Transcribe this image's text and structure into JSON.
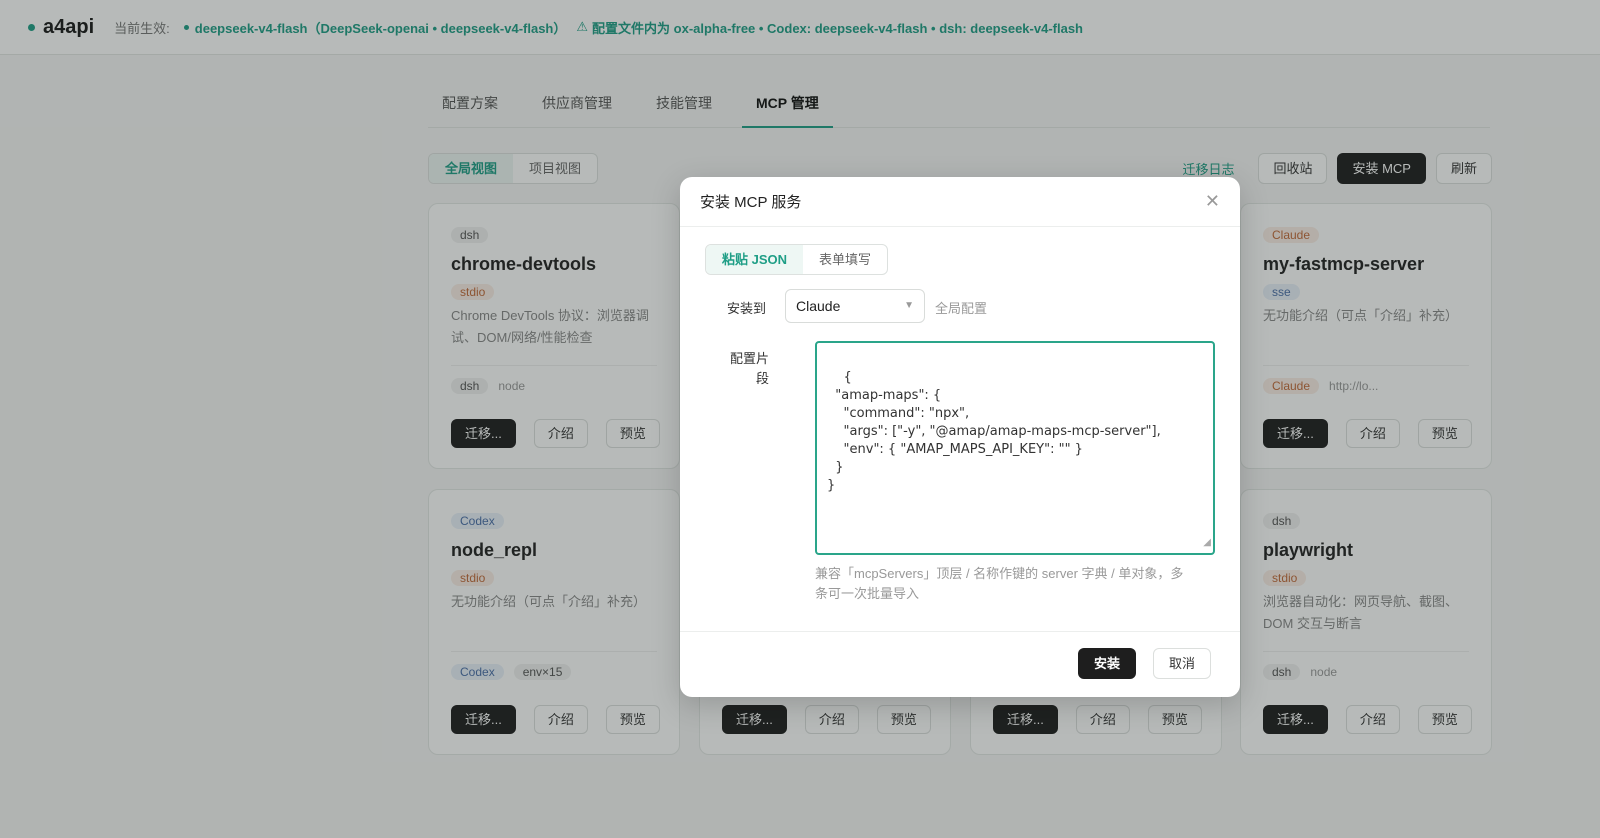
{
  "topbar": {
    "brand": "a4api",
    "current_label": "当前生效:",
    "status": "deepseek-v4-flash（DeepSeek-openai • deepseek-v4-flash）",
    "warning": "配置文件内为 ox-alpha-free • Codex: deepseek-v4-flash • dsh: deepseek-v4-flash"
  },
  "tabs": [
    "配置方案",
    "供应商管理",
    "技能管理",
    "MCP 管理"
  ],
  "view_toggle": {
    "global": "全局视图",
    "project": "项目视图"
  },
  "toolbar": {
    "migrate_log": "迁移日志",
    "recycle": "回收站",
    "install_mcp": "安装 MCP",
    "refresh": "刷新"
  },
  "cards": [
    {
      "scope": "dsh",
      "title": "chrome-devtools",
      "type": "stdio",
      "desc": "Chrome DevTools 协议：浏览器调试、DOM/网络/性能检查",
      "meta_tag": "dsh",
      "meta_text": "node"
    },
    {
      "scope": "Claude",
      "title": "my-fastmcp-server",
      "type": "sse",
      "desc": "无功能介绍（可点「介绍」补充）",
      "meta_tag": "Claude",
      "meta_text": "http://lo..."
    },
    {
      "scope": "Codex",
      "title": "node_repl",
      "type": "stdio",
      "desc": "无功能介绍（可点「介绍」补充）",
      "meta_tag": "Codex",
      "meta_text": "env×15"
    },
    {
      "scope": "dsh",
      "title": "playwright",
      "type": "stdio",
      "desc": "浏览器自动化：网页导航、截图、DOM 交互与断言",
      "meta_tag": "dsh",
      "meta_text": "node"
    }
  ],
  "card_actions": {
    "migrate": "迁移...",
    "intro": "介绍",
    "preview": "预览"
  },
  "modal": {
    "title": "安装 MCP 服务",
    "mode_json": "粘贴 JSON",
    "mode_form": "表单填写",
    "install_to_label": "安装到",
    "install_to_value": "Claude",
    "scope": "全局配置",
    "snippet_label": "配置片\n段",
    "code": "{\n  \"amap-maps\": {\n    \"command\": \"npx\",\n    \"args\": [\"-y\", \"@amap/amap-maps-mcp-server\"],\n    \"env\": { \"AMAP_MAPS_API_KEY\": \"\" }\n  }\n}",
    "hint": "兼容「mcpServers」顶层 / 名称作键的 server 字典 / 单对象，多条可一次批量导入",
    "install_btn": "安装",
    "cancel_btn": "取消"
  },
  "colors": {
    "accent": "#1f9e86",
    "dark_button": "#1e1e1e"
  }
}
